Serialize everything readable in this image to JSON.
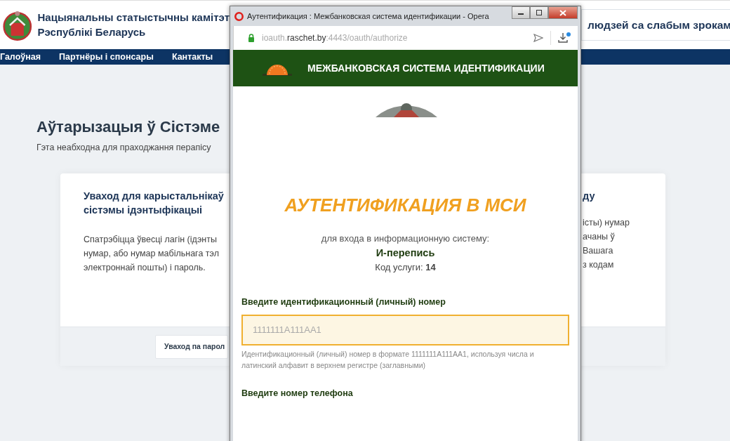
{
  "site": {
    "title_lines": [
      "Нацыянальны статыстычны камітэт",
      "Рэспублікі Беларусь"
    ],
    "accessibility_button": "людзей са слабым зрокам"
  },
  "nav": [
    {
      "label": "Галоўная"
    },
    {
      "label": "Партнёры і спонсары"
    },
    {
      "label": "Кантакты"
    }
  ],
  "page": {
    "heading": "Аўтарызацыя ў Сістэме",
    "subtitle": "Гэта неабходна для праходжання перапісу"
  },
  "cards": [
    {
      "title_lines": [
        "Уваход для карыстальнікаў",
        "сістэмы ідэнтыфікацыі"
      ],
      "body_lines": [
        "Спатрэбіцца ўвесці лагін (ідэнты",
        "нумар, або нумар мабільнага тэл",
        "электроннай пошты) і пароль."
      ],
      "button": "Уваход па парол"
    },
    {
      "title_lines": [
        "ду"
      ],
      "body_lines": [
        "істы) нумар",
        "ачаны ў",
        "Вашага",
        "з кодам"
      ]
    }
  ],
  "popup": {
    "title": "Аутентификация : Межбанковская система идентификации - Opera",
    "url_parts": [
      {
        "text": "ioauth.",
        "strong": false
      },
      {
        "text": "raschet.by",
        "strong": true
      },
      {
        "text": ":4443/oauth/authorize",
        "strong": false
      }
    ],
    "banner": "МЕЖБАНКОВСКАЯ СИСТЕМА ИДЕНТИФИКАЦИИ",
    "heading": "АУТЕНТИФИКАЦИЯ В МСИ",
    "intro": "для входа в информационную систему:",
    "system": "И-перепись",
    "service_code": "Код услуги: **14**",
    "fields": [
      {
        "label": "Введите идентификационный (личный) номер",
        "placeholder": "1111111A111AA1",
        "hint": "Идентификационный (личный) номер в формате 1111111A111AA1, используя числа и латинский алфавит в верхнем регистре (заглавными)"
      },
      {
        "label": "Введите номер телефона"
      }
    ]
  }
}
